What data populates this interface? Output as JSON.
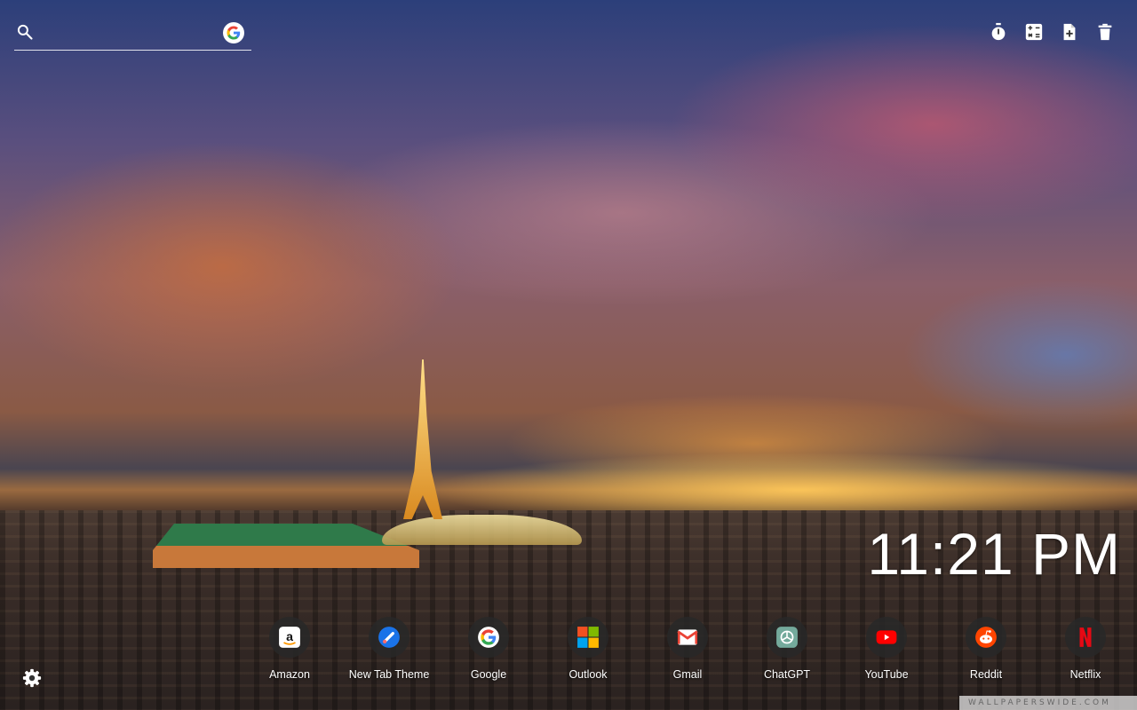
{
  "search": {
    "placeholder": "",
    "value": "",
    "icon": "search-icon",
    "engine_icon": "google-icon"
  },
  "toolbar": {
    "icons": [
      "timer-icon",
      "calculator-icon",
      "add-note-icon",
      "trash-icon"
    ]
  },
  "clock": {
    "time": "11:21 PM"
  },
  "shortcuts": [
    {
      "label": "Amazon",
      "icon": "amazon-icon"
    },
    {
      "label": "New Tab Theme",
      "icon": "new-tab-theme-icon"
    },
    {
      "label": "Google",
      "icon": "google-icon"
    },
    {
      "label": "Outlook",
      "icon": "outlook-icon"
    },
    {
      "label": "Gmail",
      "icon": "gmail-icon"
    },
    {
      "label": "ChatGPT",
      "icon": "chatgpt-icon"
    },
    {
      "label": "YouTube",
      "icon": "youtube-icon"
    },
    {
      "label": "Reddit",
      "icon": "reddit-icon"
    },
    {
      "label": "Netflix",
      "icon": "netflix-icon"
    }
  ],
  "settings": {
    "icon": "gear-icon"
  },
  "watermark": {
    "text": "WALLPAPERSWIDE.COM"
  },
  "colors": {
    "youtube": "#ff0000",
    "reddit": "#ff4500",
    "netflix": "#e50914",
    "chatgpt": "#74aa9c",
    "outlook_red": "#f25022",
    "outlook_green": "#7fba00",
    "outlook_blue": "#00a4ef",
    "outlook_yellow": "#ffb900"
  }
}
